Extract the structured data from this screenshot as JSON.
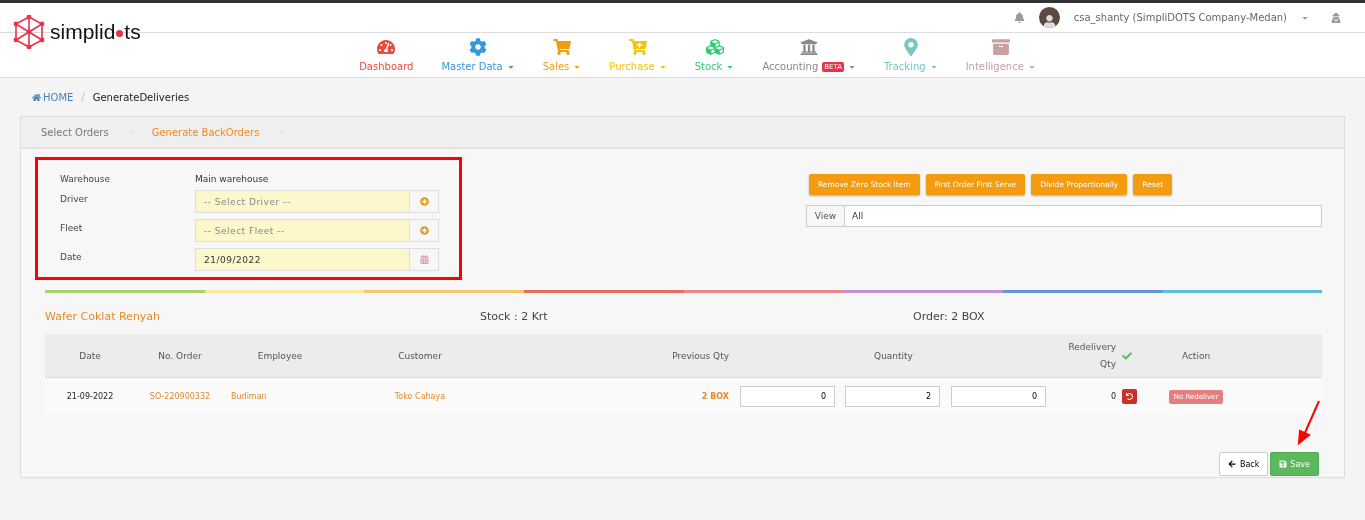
{
  "logo": {
    "parts": [
      "simplid",
      "ts"
    ]
  },
  "user": {
    "name": "csa_shanty (SimpliDOTS Company-Medan)"
  },
  "nav": [
    {
      "label": "Dashboard",
      "color": "#e74c3c",
      "dropdown": false
    },
    {
      "label": "Master Data",
      "color": "#3498db",
      "dropdown": true
    },
    {
      "label": "Sales",
      "color": "#f39c12",
      "dropdown": true
    },
    {
      "label": "Purchase",
      "color": "#f1c40f",
      "dropdown": true
    },
    {
      "label": "Stock",
      "color": "#2ecc71",
      "dropdown": true
    },
    {
      "label": "Accounting",
      "color": "#888888",
      "dropdown": true,
      "badge": "BETA"
    },
    {
      "label": "Tracking",
      "color": "#76c7c0",
      "dropdown": true
    },
    {
      "label": "Intelligence",
      "color": "#c9a0a0",
      "dropdown": true
    }
  ],
  "breadcrumb": [
    {
      "label": "HOME"
    },
    {
      "label": "GenerateDeliveries"
    }
  ],
  "breadcrumb_separator": "/",
  "steps": [
    {
      "label": "Select Orders",
      "selected": false
    },
    {
      "label": "Generate BackOrders",
      "selected": true
    }
  ],
  "form": {
    "warehouse_label": "Warehouse",
    "warehouse_value": "Main warehouse",
    "fields": [
      {
        "label": "Driver",
        "kind": "select",
        "placeholder": "-- Select Driver --"
      },
      {
        "label": "Fleet",
        "kind": "select",
        "placeholder": "-- Select Fleet --"
      },
      {
        "label": "Date",
        "kind": "date",
        "value": "21/09/2022"
      }
    ]
  },
  "actions": [
    "Remove Zero Stock Item",
    "First Order First Serve",
    "Divide Proportionally",
    "Reset"
  ],
  "view": {
    "label": "View",
    "value": "All"
  },
  "product": {
    "name": "Wafer Coklat Renyah",
    "stock": "Stock : 2 Krt",
    "order": "Order: 2 BOX"
  },
  "table": {
    "columns": [
      "Date",
      "No. Order",
      "Employee",
      "Customer",
      "Previous Qty",
      "Quantity",
      "Redelivery Qty",
      "Action"
    ],
    "rows": [
      {
        "date": "21-09-2022",
        "order": "SO-220900332",
        "employee": "Budiman",
        "customer": "Toko Cahaya",
        "previous_qty": "2 BOX",
        "quantities": [
          "0",
          "2",
          "0"
        ],
        "redelivery_qty": "0",
        "action": "No Redeliver"
      }
    ]
  },
  "buttons": {
    "back": "Back",
    "save": "Save"
  }
}
